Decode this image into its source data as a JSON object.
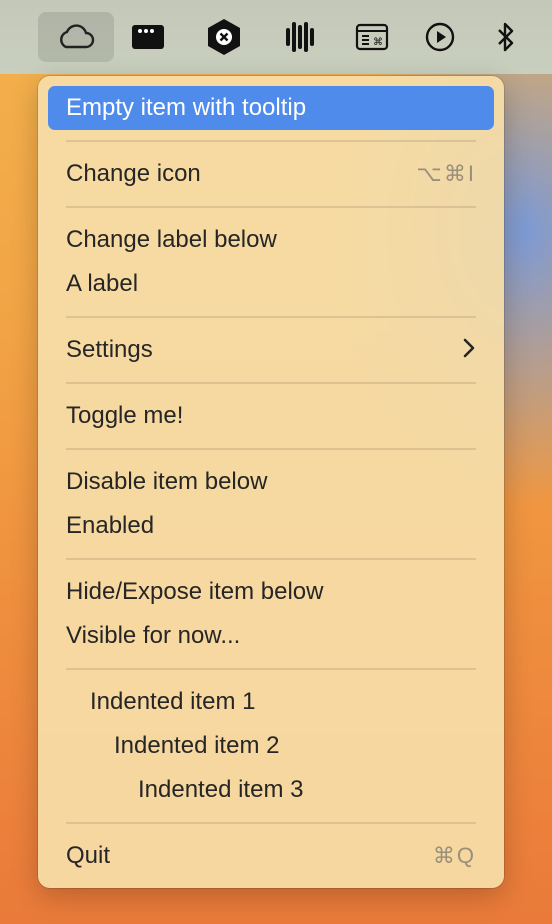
{
  "menubar": {
    "icons": [
      "cloud-icon",
      "window-dots-icon",
      "hexagon-x-icon",
      "soundwave-icon",
      "keyboard-window-icon",
      "play-circle-icon",
      "bluetooth-icon"
    ]
  },
  "menu": {
    "items": {
      "tooltip": "Empty item with tooltip",
      "change_icon": "Change icon",
      "change_icon_shortcut": "⌥⌘I",
      "change_label": "Change label below",
      "a_label": "A label",
      "settings": "Settings",
      "toggle": "Toggle me!",
      "disable_below": "Disable item below",
      "enabled": "Enabled",
      "hide_expose": "Hide/Expose item below",
      "visible": "Visible for now...",
      "indented1": "Indented item 1",
      "indented2": "Indented item 2",
      "indented3": "Indented item 3",
      "quit": "Quit",
      "quit_shortcut": "⌘Q"
    }
  },
  "colors": {
    "highlight": "#4f8bea",
    "menu_bg": "#f6dea8",
    "text": "#262626",
    "shortcut": "#9a8f7c"
  }
}
